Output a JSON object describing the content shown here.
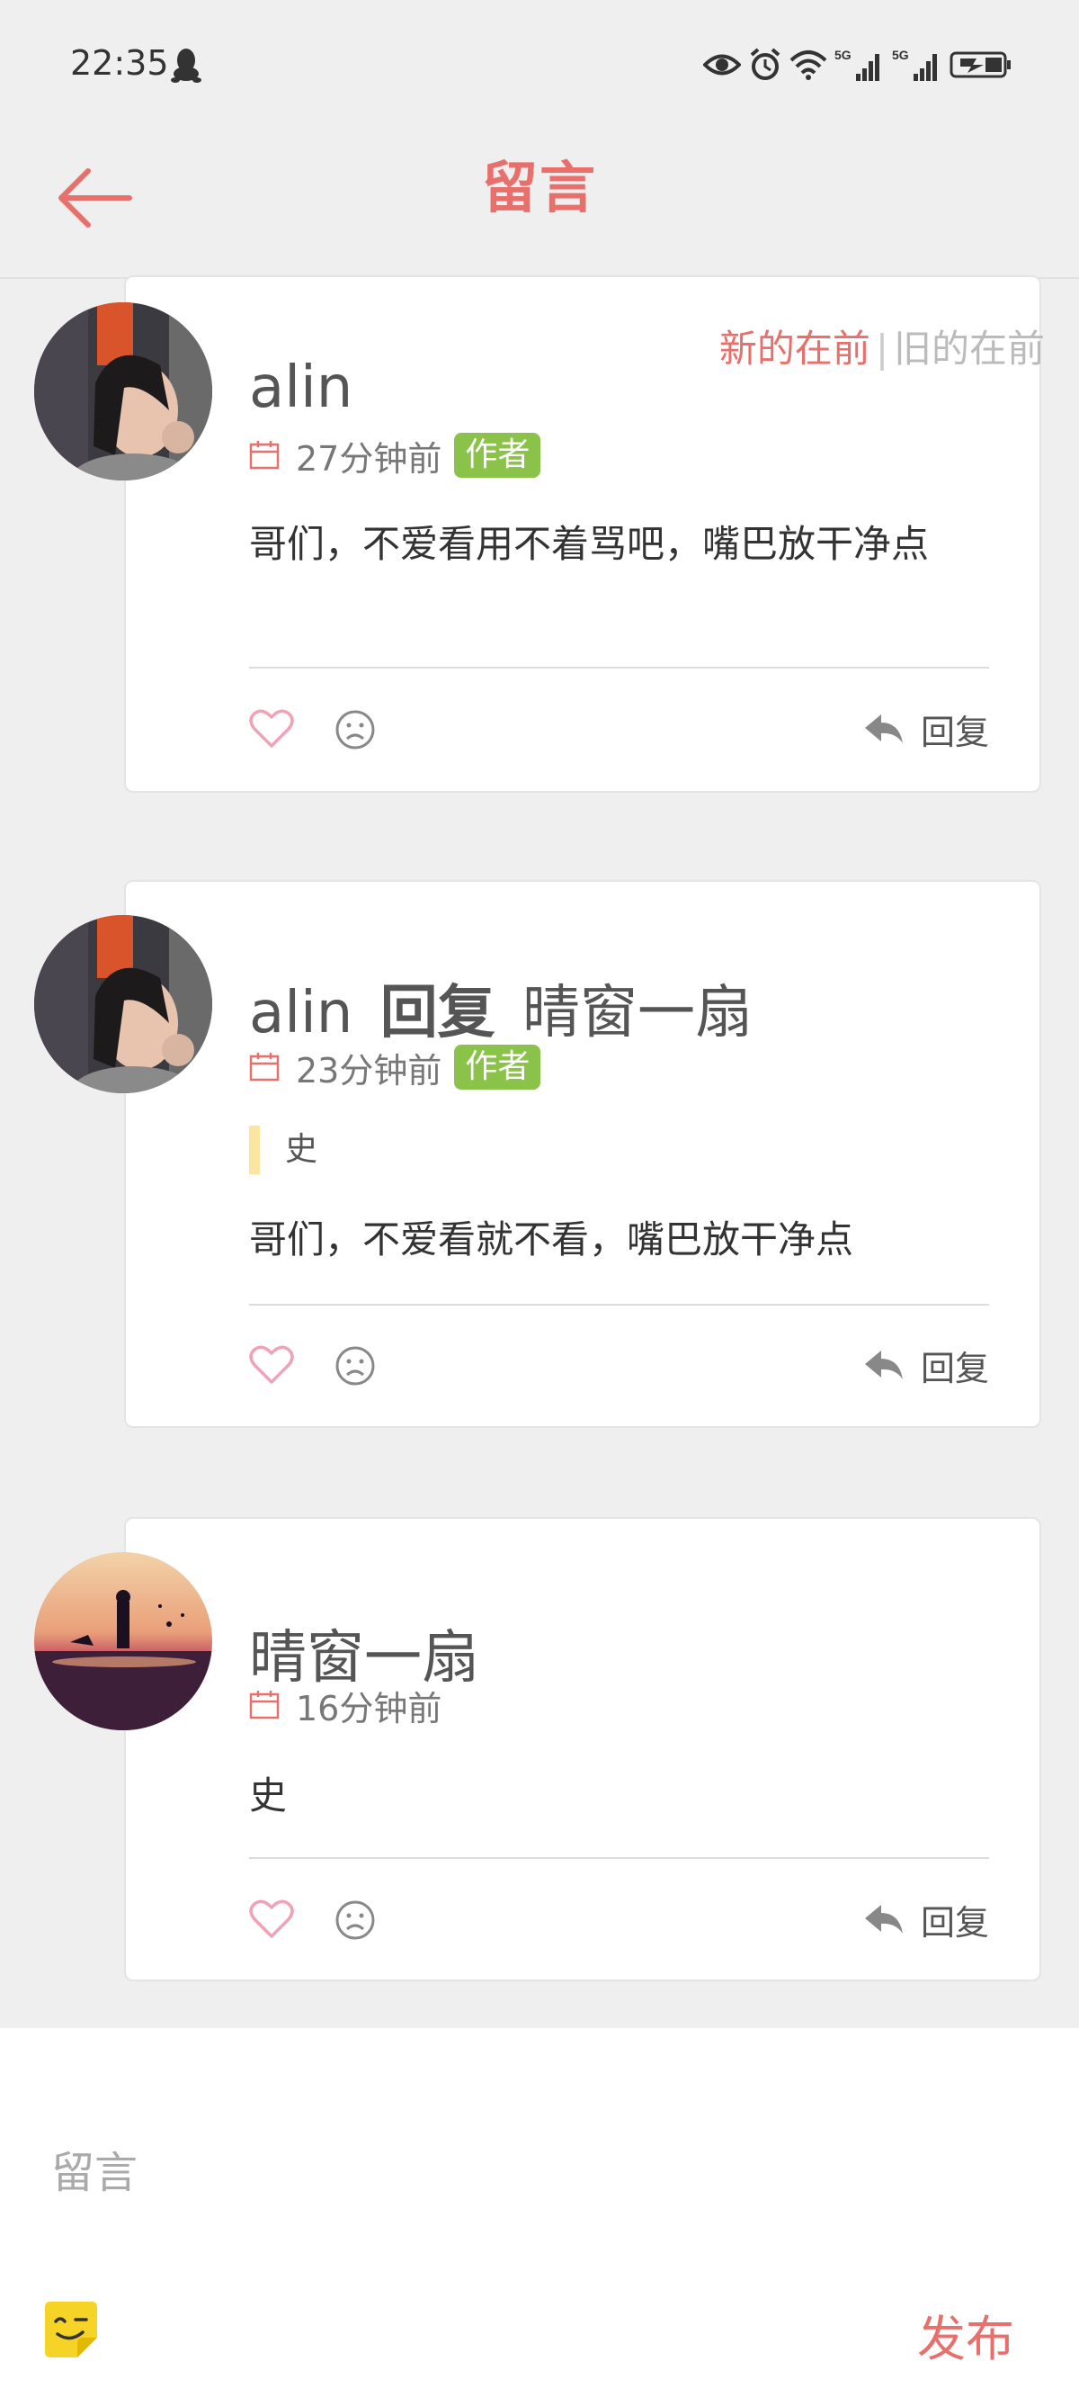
{
  "status_bar": {
    "time": "22:35",
    "network_label_1": "5G",
    "network_label_2": "5G"
  },
  "header": {
    "title": "留言"
  },
  "sort": {
    "newest": "新的在前",
    "separator": "|",
    "oldest": "旧的在前"
  },
  "comments": [
    {
      "author": "alin",
      "reply_word": "",
      "reply_to": "",
      "time": "27分钟前",
      "badge": "作者",
      "quote": "",
      "text": "哥们，不爱看用不着骂吧，嘴巴放干净点",
      "reply_label": "回复"
    },
    {
      "author": "alin",
      "reply_word": "回复",
      "reply_to": "晴窗一扇",
      "time": "23分钟前",
      "badge": "作者",
      "quote": "史",
      "text": "哥们，不爱看就不看，嘴巴放干净点",
      "reply_label": "回复"
    },
    {
      "author": "晴窗一扇",
      "reply_word": "",
      "reply_to": "",
      "time": "16分钟前",
      "badge": "",
      "quote": "",
      "text": "史",
      "reply_label": "回复"
    }
  ],
  "composer": {
    "placeholder": "留言",
    "value": "",
    "submit_label": "发布"
  },
  "icons": {
    "back": "arrow-left-icon",
    "calendar": "calendar-icon",
    "like": "heart-icon",
    "dislike": "sad-face-icon",
    "reply": "reply-arrow-icon",
    "emoji": "sticker-icon"
  },
  "colors": {
    "accent": "#e8706c",
    "author_badge": "#8bc34a",
    "quote_bar": "#fbe5a0",
    "background": "#efefef"
  }
}
